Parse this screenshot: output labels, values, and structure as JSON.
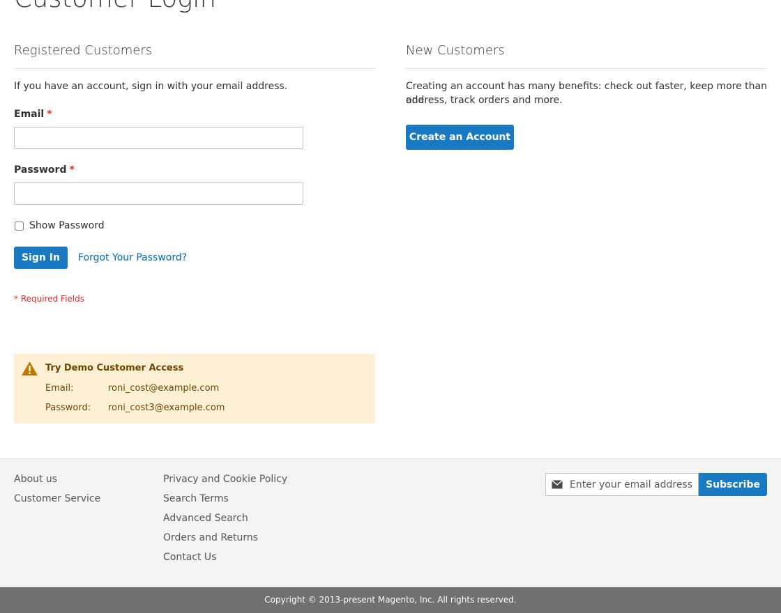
{
  "page": {
    "title": "Customer Login"
  },
  "registered": {
    "title": "Registered Customers",
    "intro": "If you have an account, sign in with your email address.",
    "email_label": "Email",
    "password_label": "Password",
    "required_mark": "*",
    "email_value": "",
    "password_value": "",
    "show_password_label": "Show Password",
    "sign_in_label": "Sign In",
    "forgot_label": "Forgot Your Password?",
    "required_note": "* Required Fields"
  },
  "new_customers": {
    "title": "New Customers",
    "text_line1": "Creating an account has many benefits: check out faster, keep more than one",
    "text_line2": "address, track orders and more.",
    "create_label": "Create an Account"
  },
  "demo": {
    "title": "Try Demo Customer Access",
    "email_key": "Email:",
    "email_value": "roni_cost@example.com",
    "password_key": "Password:",
    "password_value": "roni_cost3@example.com",
    "icon": "warning-icon"
  },
  "footer": {
    "col1": [
      "About us",
      "Customer Service"
    ],
    "col2": [
      "Privacy and Cookie Policy",
      "Search Terms",
      "Advanced Search",
      "Orders and Returns",
      "Contact Us"
    ],
    "newsletter": {
      "placeholder": "Enter your email address",
      "subscribe_label": "Subscribe",
      "icon": "envelope-icon"
    },
    "copyright": "Copyright © 2013-present Magento, Inc. All rights reserved."
  },
  "colors": {
    "primary": "#1979c3",
    "link": "#006bb4",
    "required": "#e02b27",
    "demo_bg": "#fdf0d5",
    "demo_text": "#6f4400",
    "footer_bg": "#f4f4f4",
    "copyright_bg": "#6e716e"
  }
}
